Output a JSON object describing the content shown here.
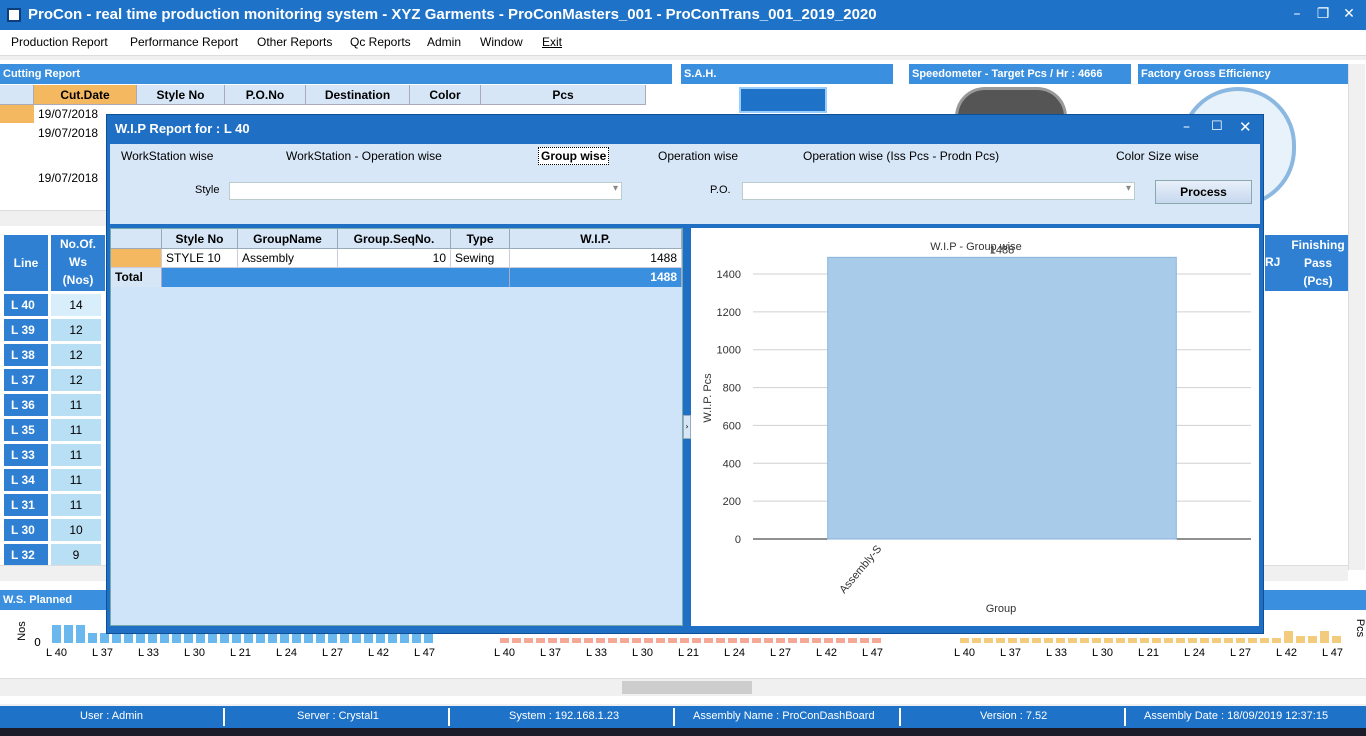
{
  "window": {
    "title": "ProCon - real time production monitoring system - XYZ Garments - ProConMasters_001 - ProConTrans_001_2019_2020",
    "min": "–",
    "max": "❐",
    "close": "✕"
  },
  "menu": [
    "Production Report",
    "Performance Report",
    "Other Reports",
    "Qc Reports",
    "Admin",
    "Window",
    "Exit"
  ],
  "panels": {
    "cutting": "Cutting Report",
    "sah": "S.A.H.",
    "speedometer": "Speedometer - Target Pcs / Hr : 4666",
    "efficiency": "Factory Gross Efficiency",
    "ws_planned": "W.S. Planned"
  },
  "cutting_grid": {
    "headers": [
      "Cut.Date",
      "Style No",
      "P.O.No",
      "Destination",
      "Color",
      "Pcs"
    ],
    "dates": [
      "19/07/2018",
      "19/07/2018",
      "19/07/2018"
    ]
  },
  "lines": {
    "header_line": "Line",
    "header_ws": [
      "No.Of.",
      "Ws",
      "(Nos)"
    ],
    "rows": [
      {
        "line": "L 40",
        "ws": "14"
      },
      {
        "line": "L 39",
        "ws": "12"
      },
      {
        "line": "L 38",
        "ws": "12"
      },
      {
        "line": "L 37",
        "ws": "12"
      },
      {
        "line": "L 36",
        "ws": "11"
      },
      {
        "line": "L 35",
        "ws": "11"
      },
      {
        "line": "L 33",
        "ws": "11"
      },
      {
        "line": "L 34",
        "ws": "11"
      },
      {
        "line": "L 31",
        "ws": "11"
      },
      {
        "line": "L 30",
        "ws": "10"
      },
      {
        "line": "L 32",
        "ws": "9"
      }
    ]
  },
  "right_cols": {
    "rj": "RJ",
    "finishing": [
      "Finishing",
      "Pass",
      "(Pcs)"
    ]
  },
  "bottom_axis_labels": [
    "L 40",
    "L 37",
    "L 33",
    "L 30",
    "L 21",
    "L 24",
    "L 27",
    "L 42",
    "L 47"
  ],
  "bottom_y": {
    "label": "Nos",
    "zero": "0",
    "pcs": "Pcs"
  },
  "dialog": {
    "title": "W.I.P Report for : L 40",
    "tabs": [
      "WorkStation wise",
      "WorkStation - Operation wise",
      "Group wise",
      "Operation wise",
      "Operation wise (Iss Pcs - Prodn Pcs)",
      "Color Size wise"
    ],
    "active_tab": "Group wise",
    "style_label": "Style",
    "po_label": "P.O.",
    "process_label": "Process",
    "grid": {
      "headers": [
        "Style No",
        "GroupName",
        "Group.SeqNo.",
        "Type",
        "W.I.P."
      ],
      "row": [
        "STYLE 10",
        "Assembly",
        "10",
        "Sewing",
        "1488"
      ],
      "total_label": "Total",
      "total": "1488"
    }
  },
  "chart_data": {
    "type": "bar",
    "title": "W.I.P - Group wise",
    "categories": [
      "Assembly-S"
    ],
    "values": [
      1488
    ],
    "data_labels": [
      "1488"
    ],
    "xlabel": "Group",
    "ylabel": "W.I.P. Pcs",
    "ylim": [
      0,
      1400
    ],
    "yticks": [
      0,
      200,
      400,
      600,
      800,
      1000,
      1200,
      1400
    ],
    "grid": true
  },
  "status": {
    "user": "User : Admin",
    "server": "Server : Crystal1",
    "system": "System : 192.168.1.23",
    "assembly": "Assembly Name : ProConDashBoard",
    "version": "Version : 7.52",
    "date": "Assembly Date : 18/09/2019 12:37:15"
  },
  "colors": {
    "accent": "#1e73c8",
    "bar": "#a9cbea",
    "header": "#3a8fde"
  }
}
